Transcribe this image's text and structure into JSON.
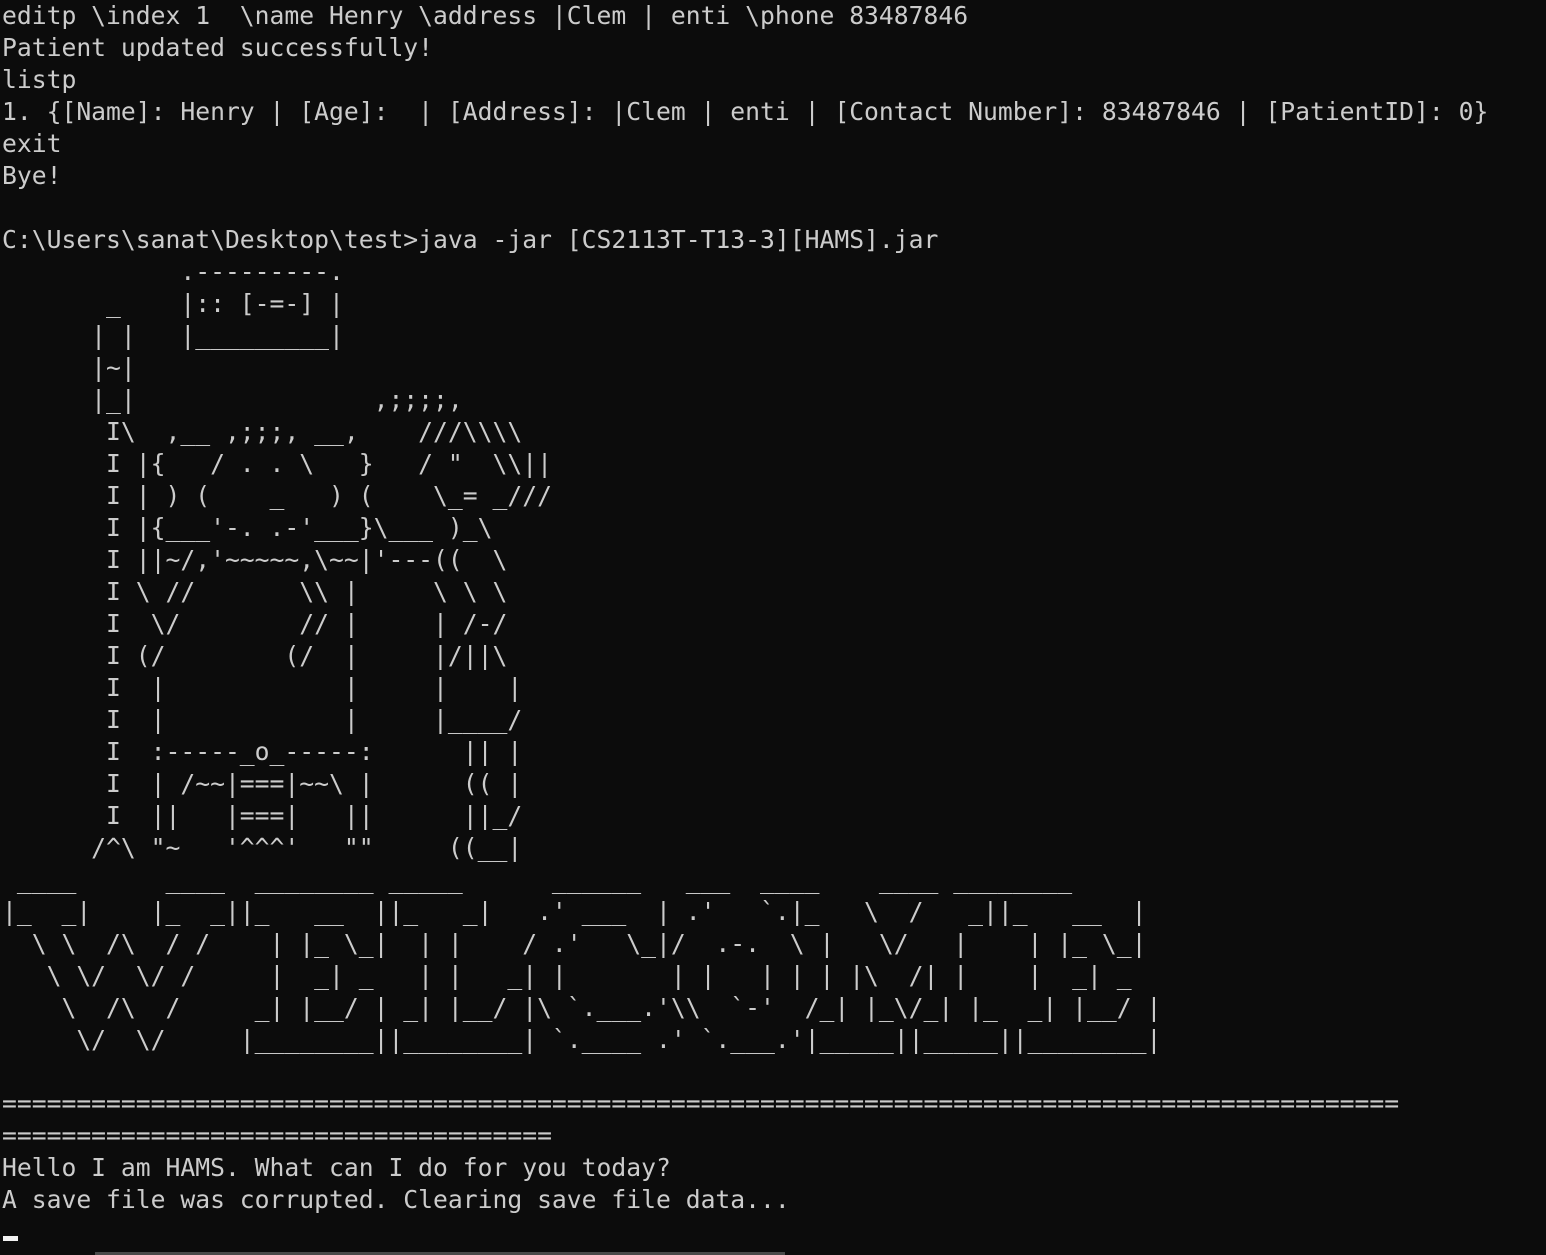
{
  "terminal": {
    "lines": [
      "editp \\index 1  \\name Henry \\address |Clem | enti \\phone 83487846",
      "Patient updated successfully!",
      "listp",
      "1. {[Name]: Henry | [Age]:  | [Address]: |Clem | enti | [Contact Number]: 83487846 | [PatientID]: 0}",
      "exit",
      "Bye!",
      "",
      "C:\\Users\\sanat\\Desktop\\test>java -jar [CS2113T-T13-3][HAMS].jar",
      "            .---------.",
      "       _    |:: [-=-] |",
      "      | |   |_________|",
      "      |~|",
      "      |_|                ,;;;;,",
      "       I\\  ,__ ,;;;, __,    ///\\\\\\\\",
      "       I |{   / . . \\   }   / \"  \\\\||",
      "       I | ) (    _   ) (    \\_= _///",
      "       I |{___'-. .-'___}\\___ )_\\",
      "       I ||~/,'~~~~~,\\~~|'---((  \\",
      "       I \\ //       \\\\ |     \\ \\ \\",
      "       I  \\/        // |     | /-/",
      "       I (/        (/  |     |/||\\",
      "       I  |            |     |    |",
      "       I  |            |     |____/",
      "       I  :-----_o_-----:      || |",
      "       I  | /~~|===|~~\\ |      (( |",
      "       I  ||   |===|   ||      ||_/",
      "      /^\\ \"~   '^^^'   \"\"     ((__|",
      " ____      ____  ________ _____      ______   ___  ____    ____ ________",
      "|_  _|    |_  _||_   __  ||_   _|   .' ___  | .'   `.|_   \\  /   _||_   __  |",
      "  \\ \\  /\\  / /    | |_ \\_|  | |    / .'   \\_|/  .-.  \\ |   \\/   |    | |_ \\_|",
      "   \\ \\/  \\/ /     |  _| _   | |   _| |       | |   | | | |\\  /| |    |  _| _",
      "    \\  /\\  /     _| |__/ | _| |__/ |\\ `.___.'\\\\  `-'  /_| |_\\/_| |_  _| |__/ |",
      "     \\/  \\/     |________||________| `.____ .' `.___.'|_____||_____||________|",
      "",
      "==============================================================================================",
      "=====================================",
      "Hello I am HAMS. What can I do for you today?",
      "A save file was corrupted. Clearing save file data..."
    ]
  }
}
